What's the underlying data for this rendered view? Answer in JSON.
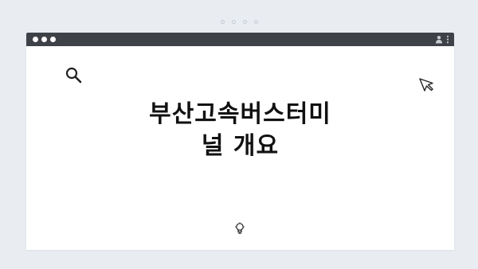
{
  "slide": {
    "title_line1": "부산고속버스터미",
    "title_line2": "널 개요"
  },
  "icons": {
    "search": "search-icon",
    "cursor": "cursor-icon",
    "user": "user-icon",
    "menu": "kebab-menu-icon",
    "bulb": "lightbulb-icon"
  },
  "colors": {
    "background": "#e9edf1",
    "titlebar": "#3e4147",
    "window": "#ffffff",
    "title_text": "#111111"
  }
}
